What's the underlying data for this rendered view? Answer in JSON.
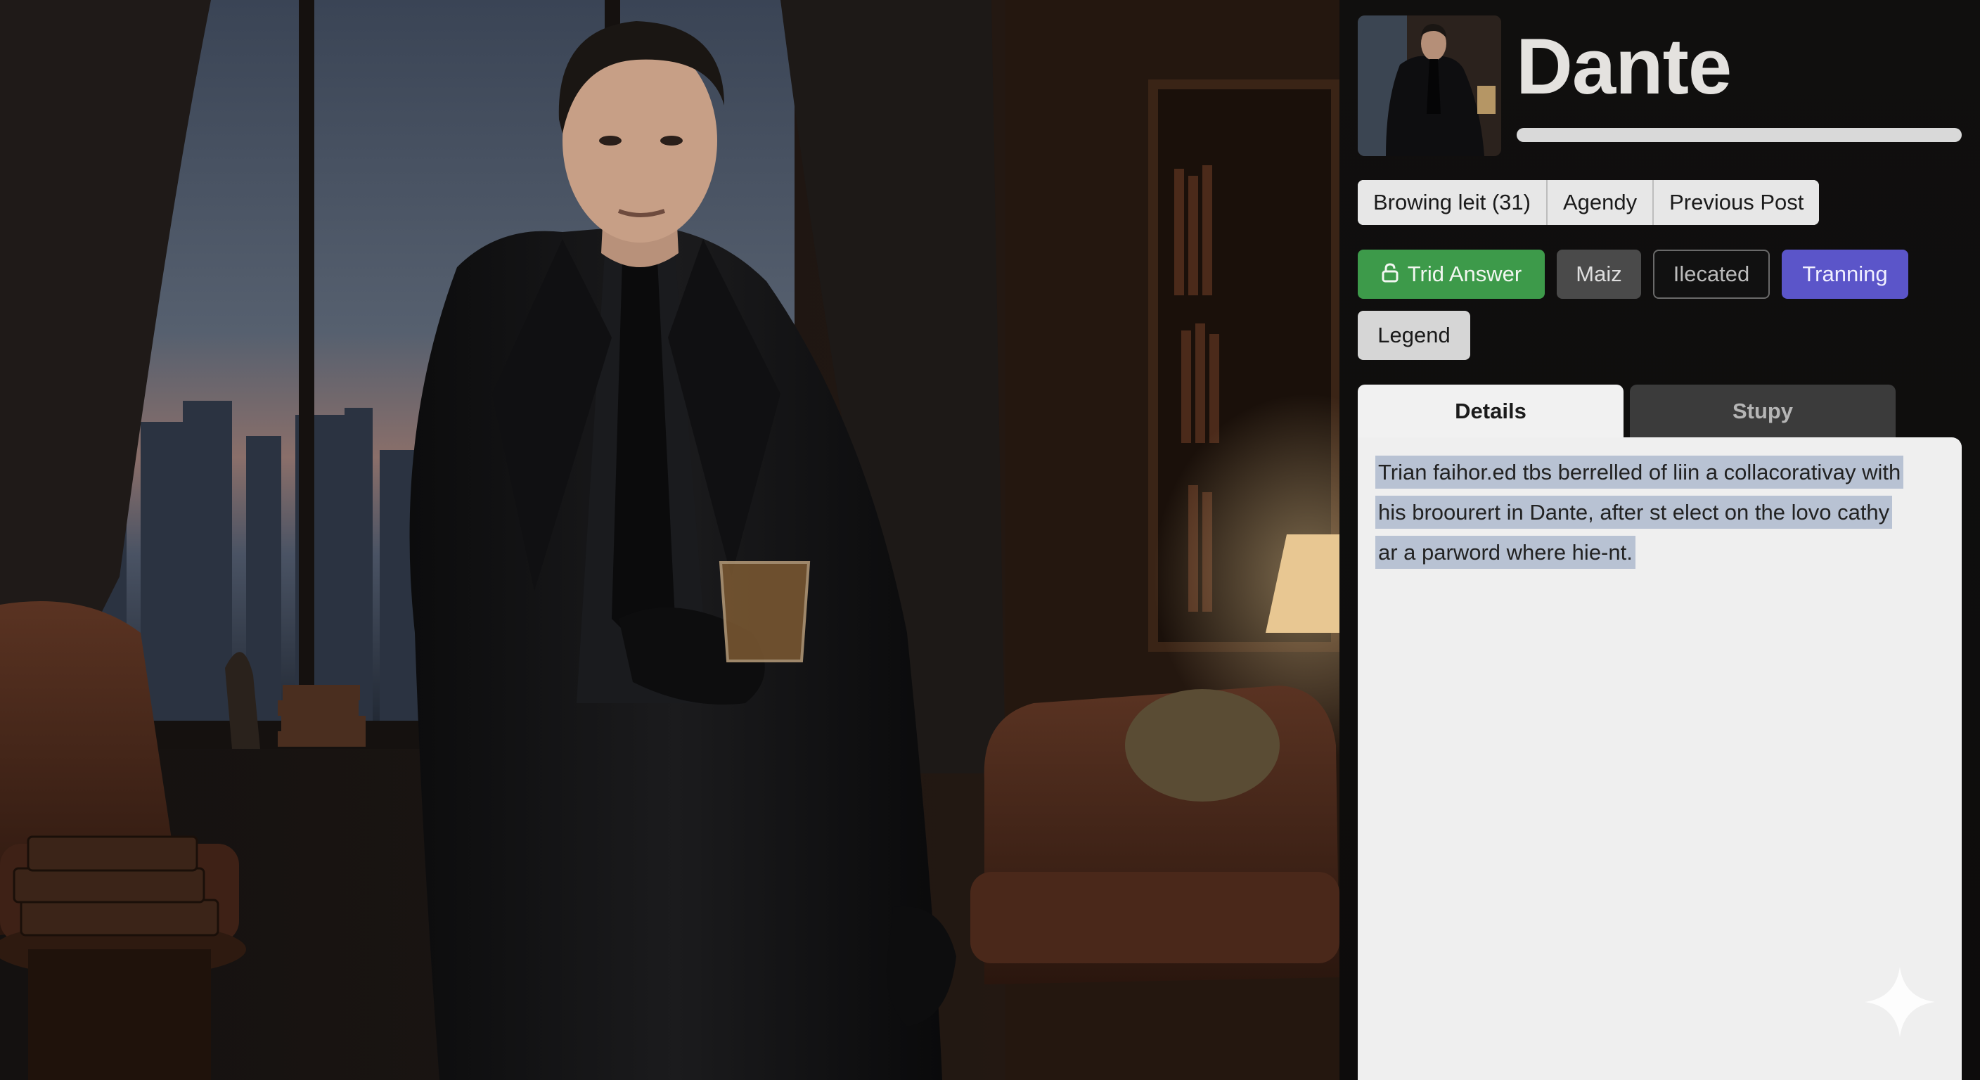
{
  "character": {
    "name": "Dante"
  },
  "segmented_tabs": [
    "Browing leit (31)",
    "Agendy",
    "Previous Post"
  ],
  "chips": {
    "trid_answer": "Trid Answer",
    "maiz": "Maiz",
    "ilecated": "Ilecated",
    "tranning": "Tranning",
    "legend": "Legend"
  },
  "tabs": {
    "details": "Details",
    "study": "Stupy"
  },
  "details_text": "Trian faihor.ed tbs berrelled of liin a collacorativay with his broourert in Dante, after st elect on the lovo cathy ar a parword where hie-nt.",
  "icons": {
    "trid_answer": "lock-icon",
    "watermark": "sparkle-icon"
  },
  "colors": {
    "accent_green": "#3d9a4a",
    "accent_purple": "#5b55c9",
    "panel_bg": "#0e0d0c",
    "highlight": "#b8c2d3"
  }
}
